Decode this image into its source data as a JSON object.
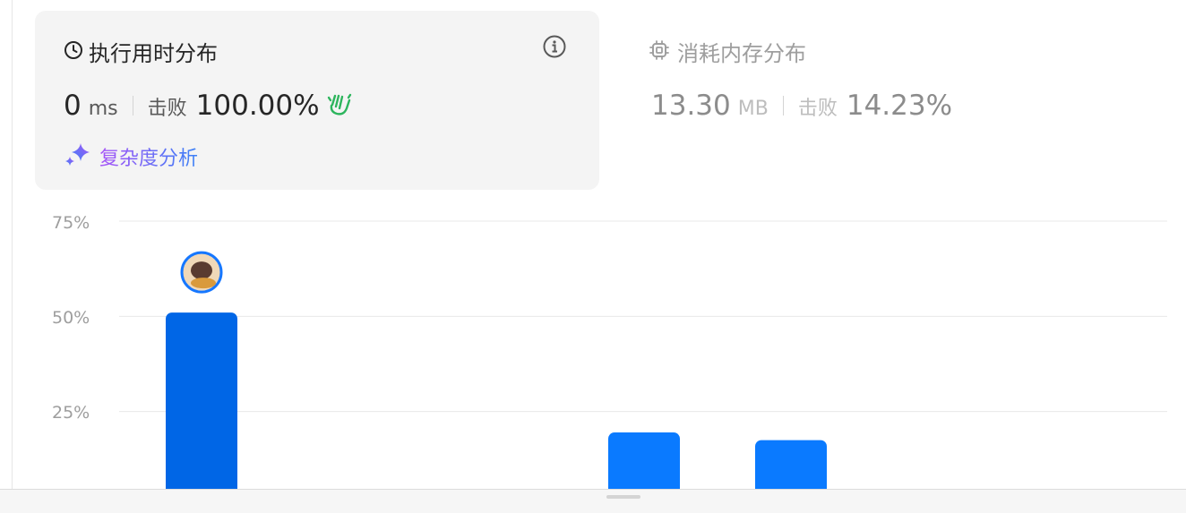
{
  "runtime": {
    "title": "执行用时分布",
    "value": "0",
    "unit": "ms",
    "beat_label": "击败",
    "beat_percent": "100.00%",
    "complexity_link": "复杂度分析"
  },
  "memory": {
    "title": "消耗内存分布",
    "value": "13.30",
    "unit": "MB",
    "beat_label": "击败",
    "beat_percent": "14.23%"
  },
  "icons": {
    "clock": "clock-icon",
    "info": "info-icon",
    "clap": "clapping-hands-icon",
    "sparkle": "sparkle-icon",
    "chip": "chip-icon"
  },
  "colors": {
    "bar_highlight": "#0066e6",
    "bar": "#0a7aff",
    "clap": "#2db55d"
  },
  "chart_data": {
    "type": "bar",
    "y_ticks": [
      "75%",
      "50%",
      "25%"
    ],
    "ylim": [
      0,
      75
    ],
    "categories": [
      "",
      "",
      ""
    ],
    "values": [
      51,
      19.5,
      17.5
    ],
    "highlighted_index": 0,
    "grid": true
  }
}
